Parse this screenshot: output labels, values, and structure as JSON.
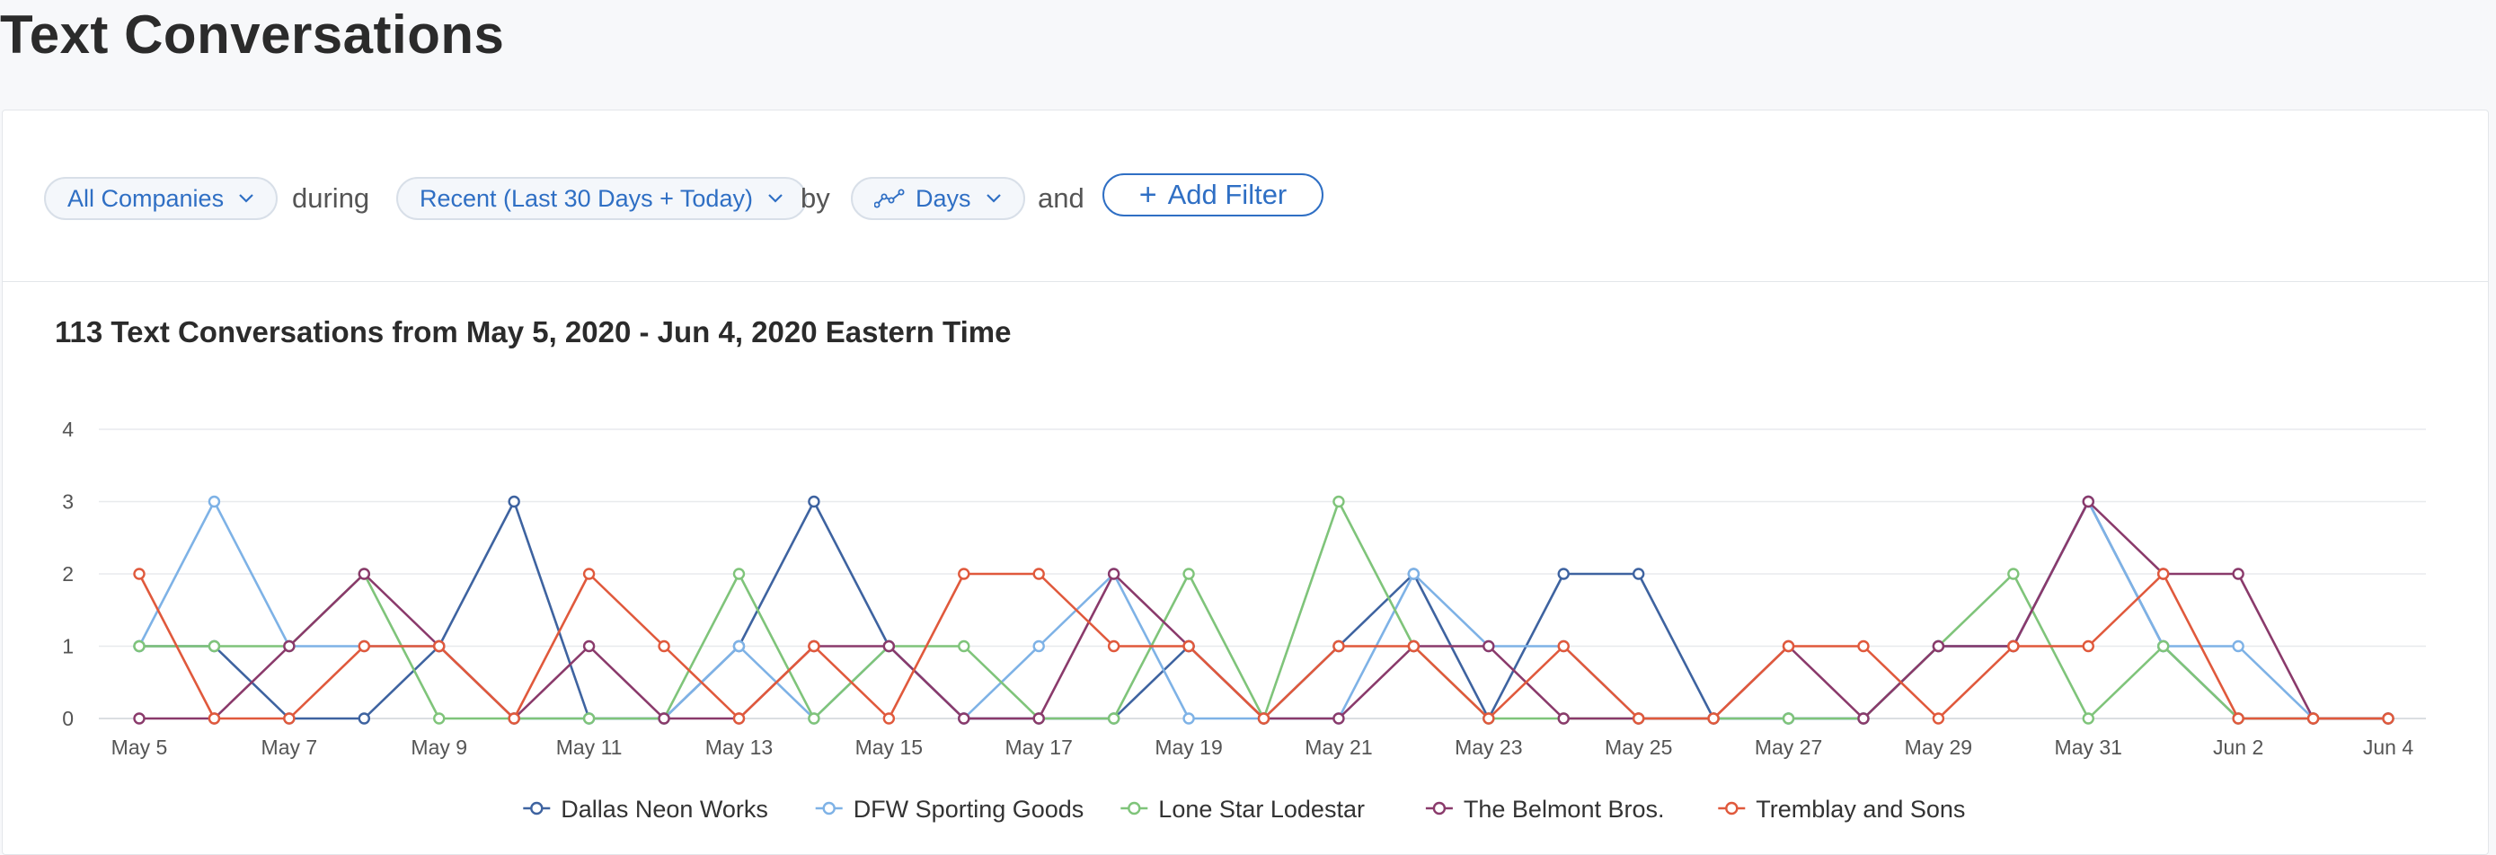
{
  "page": {
    "title": "Text Conversations"
  },
  "filters": {
    "company": "All Companies",
    "during_word": "during",
    "range": "Recent (Last 30 Days + Today)",
    "by_word": "by",
    "granularity": "Days",
    "and_word": "and",
    "add_filter": "Add Filter"
  },
  "colors": {
    "accent": "#2f6fc4",
    "Dallas Neon Works": "#3e63a0",
    "DFW Sporting Goods": "#7eb2e6",
    "Lone Star Lodestar": "#7fc47a",
    "The Belmont Bros.": "#8a3a6b",
    "Tremblay and Sons": "#e0593c"
  },
  "chart_data": {
    "type": "line",
    "title": "113 Text Conversations from May 5, 2020 - Jun 4, 2020 Eastern Time",
    "x": [
      "May 5",
      "May 6",
      "May 7",
      "May 8",
      "May 9",
      "May 10",
      "May 11",
      "May 12",
      "May 13",
      "May 14",
      "May 15",
      "May 16",
      "May 17",
      "May 18",
      "May 19",
      "May 20",
      "May 21",
      "May 22",
      "May 23",
      "May 24",
      "May 25",
      "May 26",
      "May 27",
      "May 28",
      "May 29",
      "May 30",
      "May 31",
      "Jun 1",
      "Jun 2",
      "Jun 3",
      "Jun 4"
    ],
    "x_tick_labels": [
      "May 5",
      "May 7",
      "May 9",
      "May 11",
      "May 13",
      "May 15",
      "May 17",
      "May 19",
      "May 21",
      "May 23",
      "May 25",
      "May 27",
      "May 29",
      "May 31",
      "Jun 2",
      "Jun 4"
    ],
    "y_ticks": [
      0,
      1,
      2,
      3,
      4
    ],
    "ylim": [
      0,
      4
    ],
    "grid": true,
    "legend_position": "bottom",
    "series": [
      {
        "name": "Dallas Neon Works",
        "color": "#3e63a0",
        "values": [
          1,
          1,
          0,
          0,
          1,
          3,
          0,
          0,
          1,
          3,
          1,
          0,
          0,
          0,
          1,
          0,
          1,
          2,
          0,
          2,
          2,
          0,
          0,
          0,
          1,
          1,
          3,
          1,
          0,
          0,
          0
        ]
      },
      {
        "name": "DFW Sporting Goods",
        "color": "#7eb2e6",
        "values": [
          1,
          3,
          1,
          1,
          1,
          0,
          0,
          0,
          1,
          0,
          1,
          0,
          1,
          2,
          0,
          0,
          0,
          2,
          1,
          1,
          0,
          0,
          0,
          0,
          1,
          1,
          3,
          1,
          1,
          0,
          0
        ]
      },
      {
        "name": "Lone Star Lodestar",
        "color": "#7fc47a",
        "values": [
          1,
          1,
          1,
          2,
          0,
          0,
          0,
          0,
          2,
          0,
          1,
          1,
          0,
          0,
          2,
          0,
          3,
          1,
          0,
          0,
          0,
          0,
          0,
          0,
          1,
          2,
          0,
          1,
          0,
          0,
          0
        ]
      },
      {
        "name": "The Belmont Bros.",
        "color": "#8a3a6b",
        "values": [
          0,
          0,
          1,
          2,
          1,
          0,
          1,
          0,
          0,
          1,
          1,
          0,
          0,
          2,
          1,
          0,
          0,
          1,
          1,
          0,
          0,
          0,
          1,
          0,
          1,
          1,
          3,
          2,
          2,
          0,
          0
        ]
      },
      {
        "name": "Tremblay and Sons",
        "color": "#e0593c",
        "values": [
          2,
          0,
          0,
          1,
          1,
          0,
          2,
          1,
          0,
          1,
          0,
          2,
          2,
          1,
          1,
          0,
          1,
          1,
          0,
          1,
          0,
          0,
          1,
          1,
          0,
          1,
          1,
          2,
          0,
          0,
          0
        ]
      }
    ]
  }
}
